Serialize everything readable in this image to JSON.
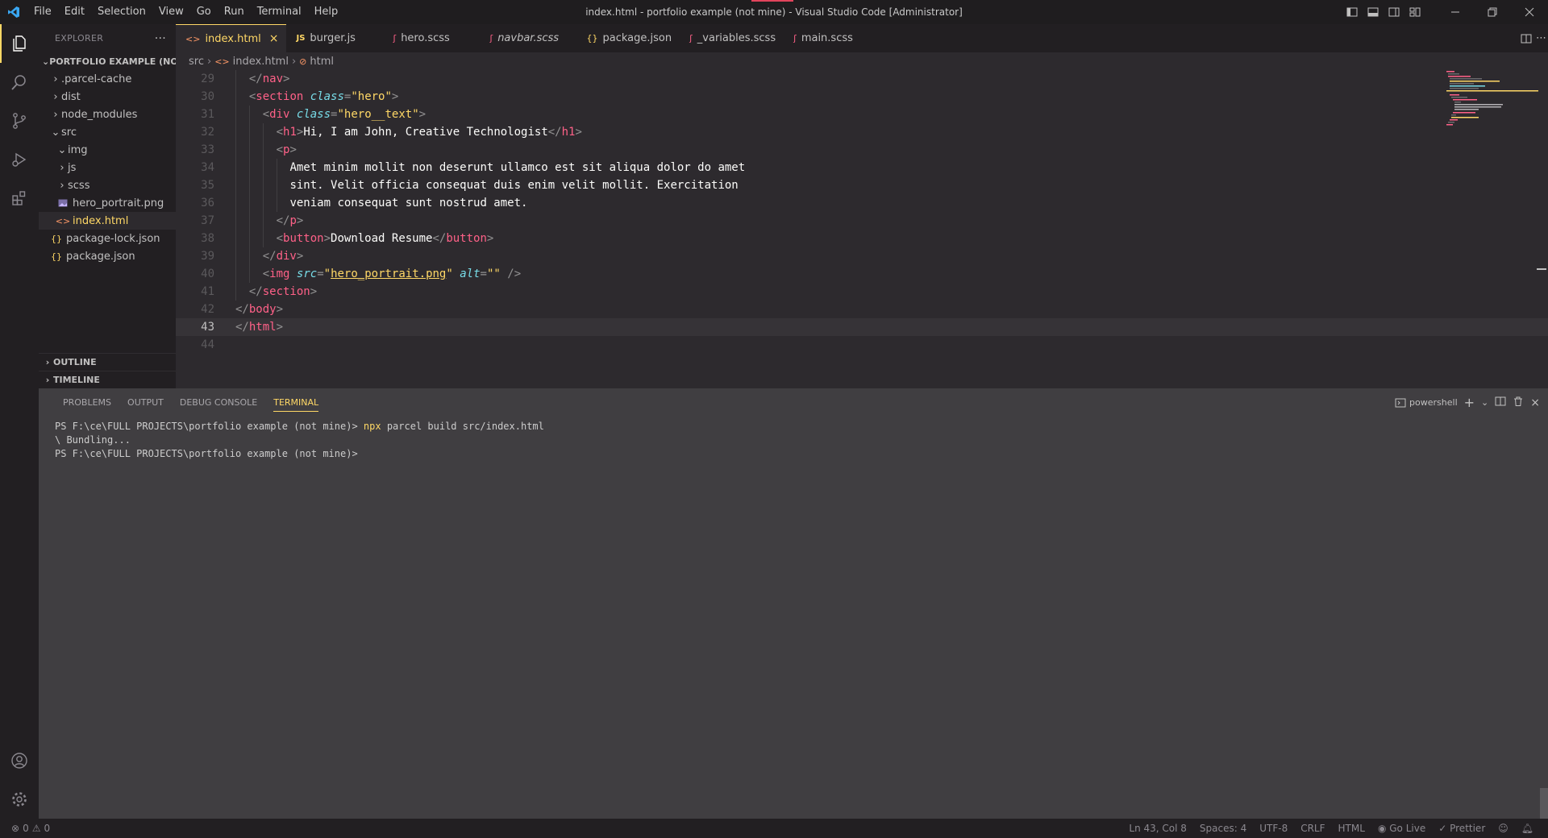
{
  "titlebar": {
    "title": "index.html - portfolio example (not mine) - Visual Studio Code [Administrator]",
    "menu": [
      "File",
      "Edit",
      "Selection",
      "View",
      "Go",
      "Run",
      "Terminal",
      "Help"
    ]
  },
  "sidebar": {
    "header": "EXPLORER",
    "root": "PORTFOLIO EXAMPLE (NO...",
    "tree": [
      {
        "label": ".parcel-cache",
        "kind": "folder"
      },
      {
        "label": "dist",
        "kind": "folder"
      },
      {
        "label": "node_modules",
        "kind": "folder"
      },
      {
        "label": "src",
        "kind": "folder-open"
      },
      {
        "label": "img",
        "kind": "folder-open"
      },
      {
        "label": "js",
        "kind": "folder"
      },
      {
        "label": "scss",
        "kind": "folder"
      },
      {
        "label": "hero_portrait.png",
        "kind": "image"
      },
      {
        "label": "index.html",
        "kind": "html"
      },
      {
        "label": "package-lock.json",
        "kind": "json"
      },
      {
        "label": "package.json",
        "kind": "json"
      }
    ],
    "outline": "OUTLINE",
    "timeline": "TIMELINE"
  },
  "tabs": [
    {
      "label": "index.html",
      "icon": "html-icon"
    },
    {
      "label": "burger.js",
      "icon": "js-icon"
    },
    {
      "label": "hero.scss",
      "icon": "scss-icon"
    },
    {
      "label": "navbar.scss",
      "icon": "scss-icon"
    },
    {
      "label": "package.json",
      "icon": "json-icon"
    },
    {
      "label": "_variables.scss",
      "icon": "scss-icon"
    },
    {
      "label": "main.scss",
      "icon": "scss-icon"
    }
  ],
  "breadcrumb": [
    "src",
    "index.html",
    "html"
  ],
  "code": {
    "current_line": "43",
    "lines": [
      {
        "n": "29",
        "t": "</nav>"
      },
      {
        "n": "30",
        "t": "<section class=\"hero\">"
      },
      {
        "n": "31",
        "t": "<div class=\"hero__text\">"
      },
      {
        "n": "32",
        "t": "<h1>Hi, I am John, Creative Technologist</h1>"
      },
      {
        "n": "33",
        "t": "<p>"
      },
      {
        "n": "34",
        "t": "Amet minim mollit non deserunt ullamco est sit aliqua dolor do amet"
      },
      {
        "n": "35",
        "t": "sint. Velit officia consequat duis enim velit mollit. Exercitation"
      },
      {
        "n": "36",
        "t": "veniam consequat sunt nostrud amet."
      },
      {
        "n": "37",
        "t": "</p>"
      },
      {
        "n": "38",
        "t": "<button>Download Resume</button>"
      },
      {
        "n": "39",
        "t": "</div>"
      },
      {
        "n": "40",
        "t": "<img src=\"hero_portrait.png\" alt=\"\" />"
      },
      {
        "n": "41",
        "t": "</section>"
      },
      {
        "n": "42",
        "t": "</body>"
      },
      {
        "n": "43",
        "t": "</html>"
      },
      {
        "n": "44",
        "t": ""
      }
    ]
  },
  "panel": {
    "tabs": [
      "PROBLEMS",
      "OUTPUT",
      "DEBUG CONSOLE",
      "TERMINAL"
    ],
    "shell": "powershell",
    "terminal": [
      {
        "prompt": "PS F:\\ce\\FULL PROJECTS\\portfolio example (not mine)> ",
        "cmd": "npx",
        "rest": " parcel build src/index.html"
      },
      {
        "prompt": "\\ Bundling...",
        "cmd": "",
        "rest": ""
      },
      {
        "prompt": "PS F:\\ce\\FULL PROJECTS\\portfolio example (not mine)>",
        "cmd": "",
        "rest": ""
      }
    ]
  },
  "statusbar": {
    "errors": "0",
    "warnings": "0",
    "position": "Ln 43, Col 8",
    "spaces": "Spaces: 4",
    "encoding": "UTF-8",
    "eol": "CRLF",
    "language": "HTML",
    "golive": "Go Live",
    "prettier": "Prettier"
  },
  "colors": {
    "accent": "#ffd866",
    "tag": "#ff6188",
    "attr": "#78dce8",
    "background": "#2d2a2e"
  }
}
